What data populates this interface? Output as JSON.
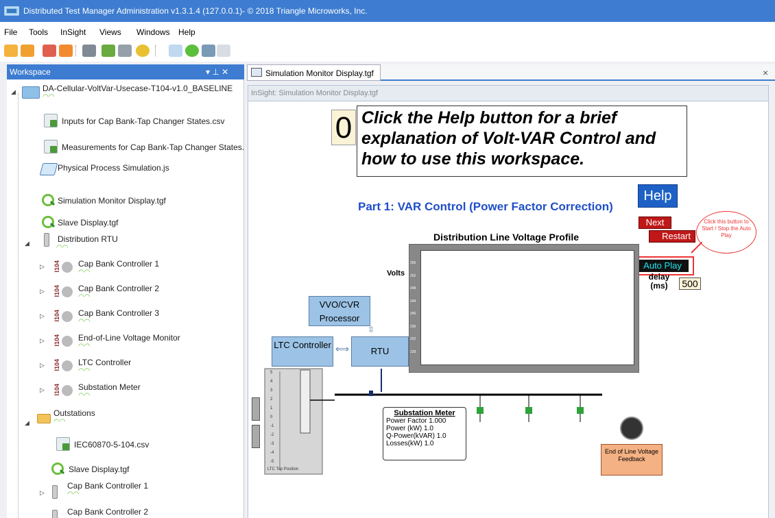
{
  "app": {
    "title": "Distributed Test Manager Administration v1.3.1.4 (127.0.0.1)- © 2018 Triangle Microworks, Inc.",
    "menu": [
      "File",
      "Tools",
      "InSight",
      "Views",
      "Windows",
      "Help"
    ]
  },
  "workspace": {
    "header": "Workspace",
    "pin_glyph": "▾ ⊥ ✕",
    "root": "DA-Cellular-VoltVar-Usecase-T104-v1.0_BASELINE",
    "items": [
      "Inputs for Cap Bank-Tap Changer States.csv",
      "Measurements for Cap Bank-Tap Changer States.cs",
      "Physical Process Simulation.js",
      "Simulation Monitor Display.tgf",
      "Slave Display.tgf",
      "Distribution RTU",
      "Cap Bank Controller 1",
      "Cap Bank Controller 2",
      "Cap Bank Controller 3",
      "End-of-Line Voltage Monitor",
      "LTC Controller",
      "Substation Meter",
      "Outstations",
      "IEC60870-5-104.csv",
      "Slave Display.tgf",
      "Cap Bank Controller 1",
      "Cap Bank Controller 2"
    ],
    "tag": "I104"
  },
  "document": {
    "tab": "Simulation Monitor Display.tgf",
    "caption": "InSight: Simulation Monitor Display.tgf",
    "close": "×"
  },
  "display": {
    "step_number": "0",
    "instruction": "Click the Help button for a brief explanation of Volt-VAR Control and how to use this workspace.",
    "part_title": "Part 1: VAR Control (Power Factor Correction)",
    "help_label": "Help",
    "next_label": "Next",
    "restart_label": "Restart",
    "autoplay_label": "Auto Play",
    "callout": "Click this button to Start / Stop the Auto Play",
    "delay_label": "delay (ms)",
    "delay_value": "500",
    "chart_title": "Distribution Line Voltage Profile",
    "volts_label": "Volts",
    "y_ticks": [
      "256",
      "252",
      "248",
      "244",
      "240",
      "236",
      "232",
      "228",
      "224"
    ],
    "vvo_label": "VVO/CVR Processor",
    "ltc_label": "LTC Controller",
    "rtu_label": "RTU",
    "tap_ticks": [
      "5",
      "4",
      "3",
      "2",
      "1",
      "0",
      "-1",
      "-2",
      "-3",
      "-4",
      "-5"
    ],
    "tap_caption": "LTC Tap Position",
    "meter": {
      "title": "Substation Meter",
      "rows": [
        [
          "Power Factor",
          "1.000"
        ],
        [
          "Power (kW)",
          "1.0"
        ],
        [
          "Q-Power(kVAR)",
          "1.0"
        ],
        [
          "Losses(kW)",
          "1.0"
        ]
      ]
    },
    "eol_label": "End of Line Voltage Feedback"
  },
  "colors": {
    "accent": "#3d7cd0",
    "highlight": "#e33"
  }
}
